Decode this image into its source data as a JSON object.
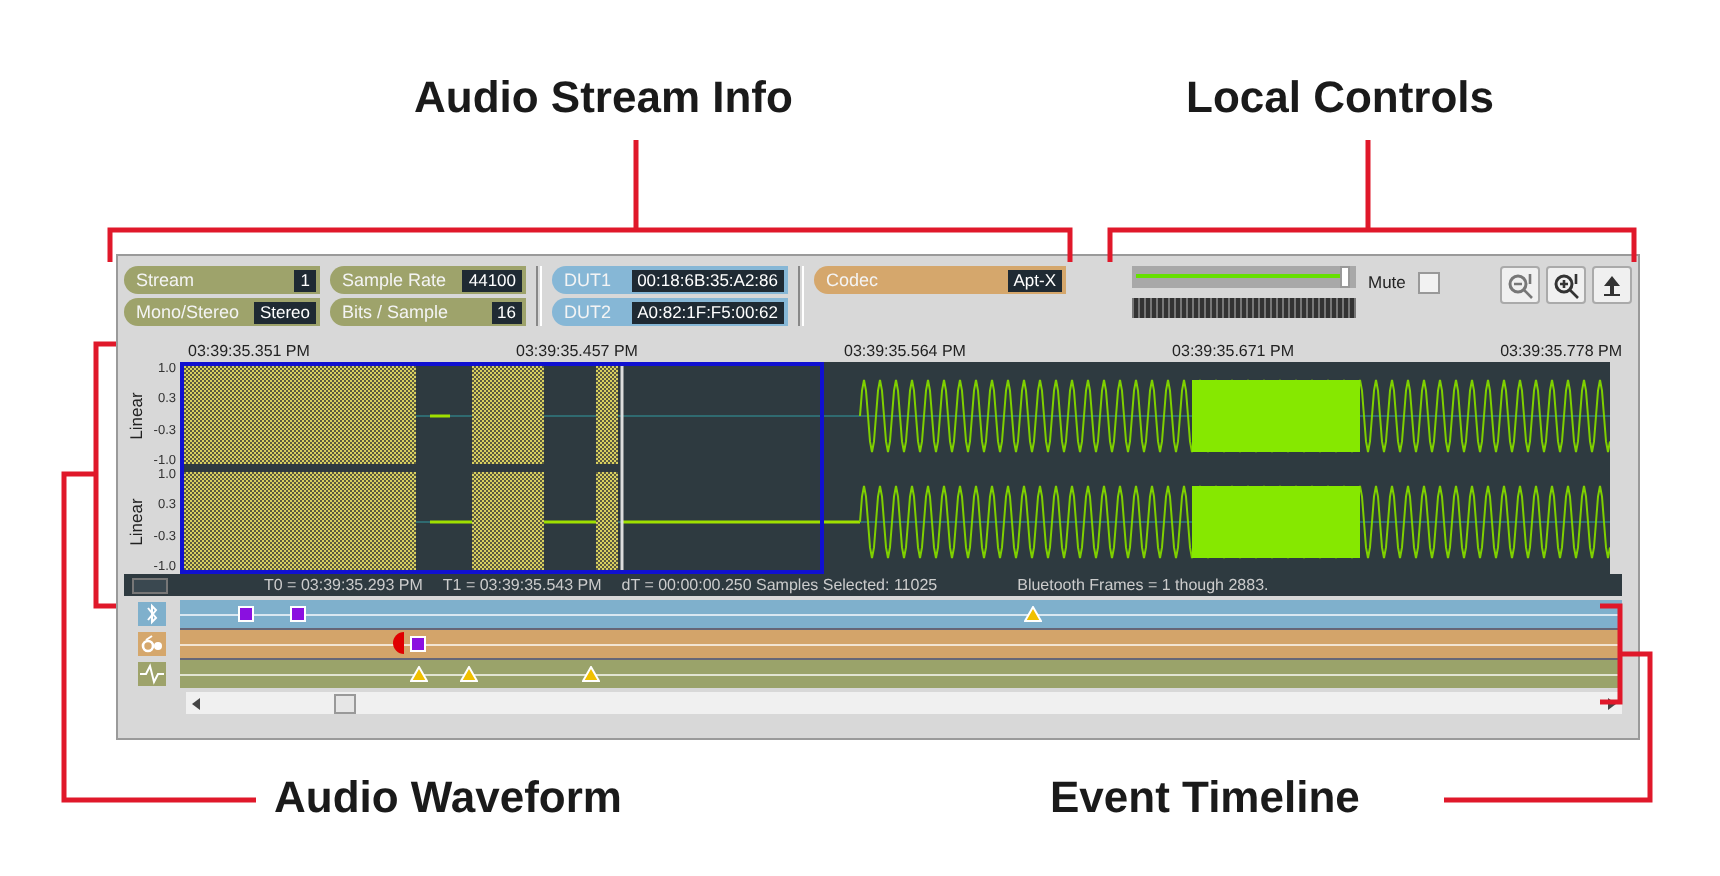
{
  "annotations": [
    {
      "label": "Audio Stream Info"
    },
    {
      "label": "Local Controls"
    },
    {
      "label": "Audio Waveform"
    },
    {
      "label": "Event Timeline"
    }
  ],
  "stream_info": {
    "fields": [
      {
        "label": "Stream",
        "value": "1"
      },
      {
        "label": "Mono/Stereo",
        "value": "Stereo"
      },
      {
        "label": "Sample Rate",
        "value": "44100"
      },
      {
        "label": "Bits / Sample",
        "value": "16"
      }
    ],
    "devices": [
      {
        "label": "DUT1",
        "value": "00:18:6B:35:A2:86"
      },
      {
        "label": "DUT2",
        "value": "A0:82:1F:F5:00:62"
      }
    ],
    "codec": {
      "label": "Codec",
      "value": "Apt-X"
    }
  },
  "local_controls": {
    "volume": {
      "level": 0.97
    },
    "mute": {
      "label": "Mute",
      "checked": false
    }
  },
  "waveform": {
    "time_labels": [
      "03:39:35.351 PM",
      "03:39:35.457 PM",
      "03:39:35.564 PM",
      "03:39:35.671 PM",
      "03:39:35.778 PM"
    ],
    "channels": [
      {
        "scale": "Linear",
        "ticks": [
          "1.0",
          "0.3",
          "-0.3",
          "-1.0"
        ]
      },
      {
        "scale": "Linear",
        "ticks": [
          "1.0",
          "0.3",
          "-0.3",
          "-1.0"
        ]
      }
    ],
    "status": [
      "T0 = 03:39:35.293 PM",
      "T1 = 03:39:35.543 PM",
      "dT = 00:00:00.250 Samples Selected: 11025",
      "Bluetooth Frames = 1 though 2883."
    ]
  },
  "timeline": {
    "lanes": [
      {
        "kind": "bluetooth",
        "color": "#7fb0cc"
      },
      {
        "kind": "device",
        "color": "#d3a46a"
      },
      {
        "kind": "audio",
        "color": "#9aa36a"
      }
    ]
  }
}
